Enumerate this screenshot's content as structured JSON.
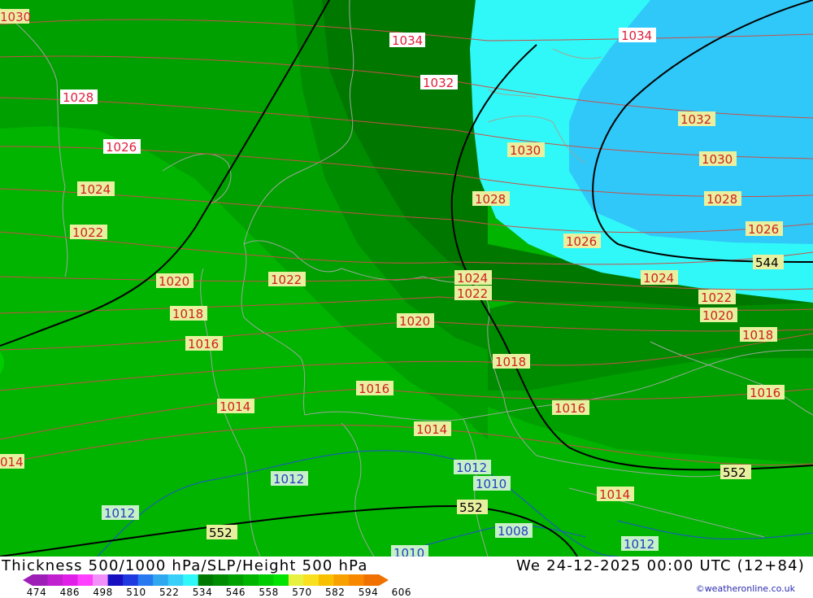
{
  "footer": {
    "title": "Thickness 500/1000 hPa/SLP/Height 500 hPa",
    "datetime": "We 24-12-2025 00:00 UTC (12+84)",
    "credit": "©weatheronline.co.uk"
  },
  "legend": {
    "ticks": [
      "474",
      "486",
      "498",
      "510",
      "522",
      "534",
      "546",
      "558",
      "570",
      "582",
      "594",
      "606"
    ],
    "colors": [
      "#9e1fb8",
      "#c020d0",
      "#e020e8",
      "#ff40ff",
      "#f090f8",
      "#1810c0",
      "#2038e0",
      "#2878f0",
      "#30a8f0",
      "#38d0f8",
      "#30f8f8",
      "#007800",
      "#008c00",
      "#00a000",
      "#00b400",
      "#00cc00",
      "#00e400",
      "#e8f040",
      "#f8e020",
      "#f8c000",
      "#f8a000",
      "#f88800",
      "#f07000"
    ]
  },
  "colors": {
    "thickness_zones": [
      "#00b400",
      "#00a000",
      "#008c00",
      "#007800",
      "#30f8f8",
      "#30c8f8"
    ],
    "slp_isobar": "#c8504a",
    "slp_label_bg": "#e8f0a0",
    "slp_label_text_high": "#e0203a",
    "slp_label_text_low": "#d02020",
    "low_pressure_isobar": "#2050d0",
    "low_pressure_label_bg": "#c8f0c8",
    "height_contour": "#000000",
    "height_label_bg": "#e8f0a0",
    "borders": "#a8a8a8"
  },
  "map": {
    "slp_labels": [
      {
        "text": "1030"
      },
      {
        "text": "1034"
      },
      {
        "text": "1034"
      },
      {
        "text": "1032"
      },
      {
        "text": "1028"
      },
      {
        "text": "1032"
      },
      {
        "text": "1026"
      },
      {
        "text": "1030"
      },
      {
        "text": "1030"
      },
      {
        "text": "1024"
      },
      {
        "text": "1028"
      },
      {
        "text": "1028"
      },
      {
        "text": "1022"
      },
      {
        "text": "1026"
      },
      {
        "text": "1026"
      },
      {
        "text": "1020"
      },
      {
        "text": "1022"
      },
      {
        "text": "1024"
      },
      {
        "text": "1024"
      },
      {
        "text": "1022"
      },
      {
        "text": "1022"
      },
      {
        "text": "1018"
      },
      {
        "text": "1020"
      },
      {
        "text": "1020"
      },
      {
        "text": "1016"
      },
      {
        "text": "1018"
      },
      {
        "text": "1018"
      },
      {
        "text": "1016"
      },
      {
        "text": "1016"
      },
      {
        "text": "1014"
      },
      {
        "text": "1016"
      },
      {
        "text": "1014"
      },
      {
        "text": "014"
      },
      {
        "text": "1014"
      }
    ],
    "low_pressure_labels": [
      {
        "text": "1012"
      },
      {
        "text": "1012"
      },
      {
        "text": "1010"
      },
      {
        "text": "1012"
      },
      {
        "text": "1008"
      },
      {
        "text": "1012"
      },
      {
        "text": "1010"
      }
    ],
    "height_labels": [
      {
        "text": "544"
      },
      {
        "text": "552"
      },
      {
        "text": "552"
      },
      {
        "text": "552"
      }
    ]
  }
}
